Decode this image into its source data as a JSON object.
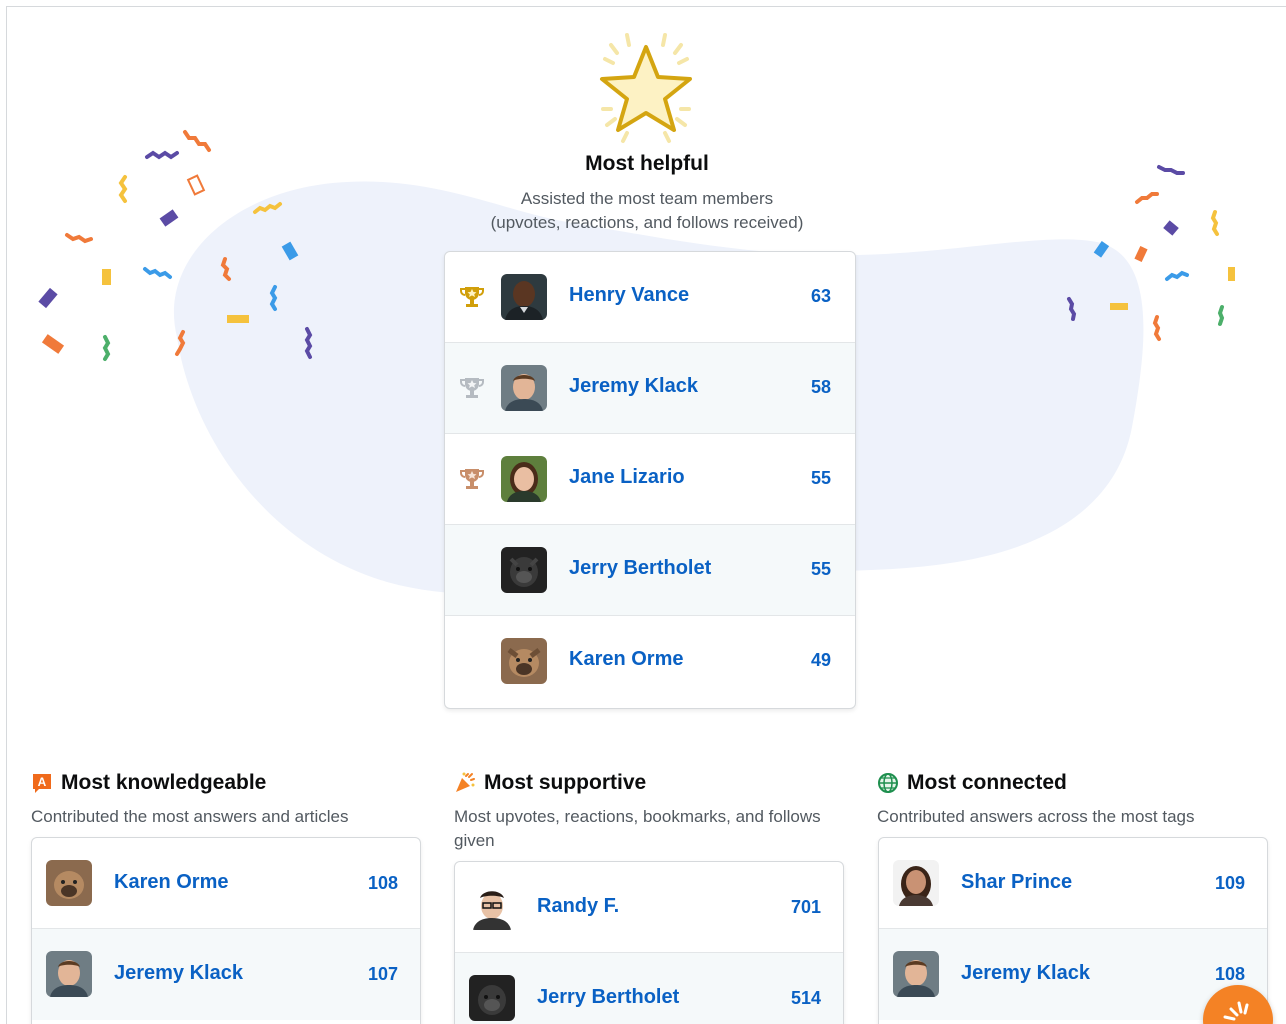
{
  "hero": {
    "icon": "star-icon",
    "title": "Most helpful",
    "subtitle_line1": "Assisted the most team members",
    "subtitle_line2": "(upvotes, reactions, and follows received)"
  },
  "most_helpful": [
    {
      "name": "Henry Vance",
      "score": "63",
      "trophy": "gold-trophy-icon"
    },
    {
      "name": "Jeremy Klack",
      "score": "58",
      "trophy": "silver-trophy-icon"
    },
    {
      "name": "Jane Lizario",
      "score": "55",
      "trophy": "bronze-trophy-icon"
    },
    {
      "name": "Jerry Bertholet",
      "score": "55"
    },
    {
      "name": "Karen Orme",
      "score": "49"
    }
  ],
  "sections": {
    "knowledgeable": {
      "icon": "answer-icon",
      "icon_letter": "A",
      "title": "Most knowledgeable",
      "description": "Contributed the most answers and articles",
      "rows": [
        {
          "name": "Karen Orme",
          "score": "108"
        },
        {
          "name": "Jeremy Klack",
          "score": "107"
        }
      ]
    },
    "supportive": {
      "icon": "party-popper-icon",
      "title": "Most supportive",
      "description": "Most upvotes, reactions, bookmarks, and follows given",
      "rows": [
        {
          "name": "Randy F.",
          "score": "701"
        },
        {
          "name": "Jerry Bertholet",
          "score": "514"
        }
      ]
    },
    "connected": {
      "icon": "globe-icon",
      "title": "Most connected",
      "description": "Contributed answers across the most tags",
      "rows": [
        {
          "name": "Shar Prince",
          "score": "109"
        },
        {
          "name": "Jeremy Klack",
          "score": "108"
        }
      ]
    }
  },
  "colors": {
    "link": "#0a61c4",
    "gold": "#d19f0a",
    "silver": "#9aa1a8",
    "bronze": "#c88e6a",
    "accent": "#f48225"
  },
  "fab": {
    "icon": "spark-icon"
  }
}
